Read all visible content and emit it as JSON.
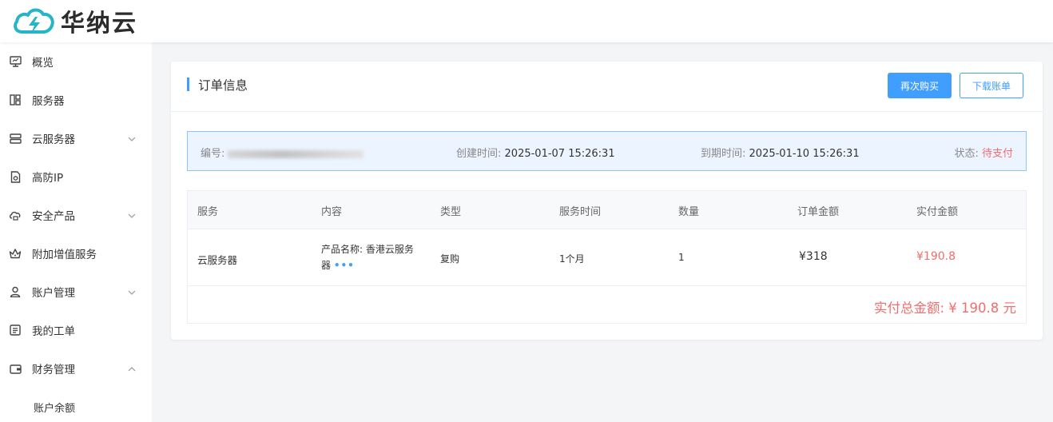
{
  "brand": {
    "name": "华纳云",
    "accent": "#409eff",
    "logo_color": "#25b4c8"
  },
  "sidebar": {
    "items": [
      {
        "label": "概览",
        "icon": "monitor-icon",
        "expandable": false
      },
      {
        "label": "服务器",
        "icon": "layout-icon",
        "expandable": false
      },
      {
        "label": "云服务器",
        "icon": "server-icon",
        "expandable": true,
        "expanded": false
      },
      {
        "label": "高防IP",
        "icon": "shield-doc-icon",
        "expandable": false
      },
      {
        "label": "安全产品",
        "icon": "cloud-lock-icon",
        "expandable": true,
        "expanded": false
      },
      {
        "label": "附加增值服务",
        "icon": "crown-icon",
        "expandable": false
      },
      {
        "label": "账户管理",
        "icon": "user-icon",
        "expandable": true,
        "expanded": false
      },
      {
        "label": "我的工单",
        "icon": "ticket-icon",
        "expandable": false
      },
      {
        "label": "财务管理",
        "icon": "wallet-icon",
        "expandable": true,
        "expanded": true
      }
    ],
    "sub_items": [
      {
        "label": "账户余额"
      }
    ]
  },
  "order": {
    "title": "订单信息",
    "buttons": {
      "buy_again": "再次购买",
      "download_bill": "下载账单"
    },
    "info": {
      "id_label": "编号:",
      "created_label": "创建时间:",
      "created_value": "2025-01-07 15:26:31",
      "expire_label": "到期时间:",
      "expire_value": "2025-01-10 15:26:31",
      "status_label": "状态:",
      "status_value": "待支付"
    },
    "table": {
      "headers": [
        "服务",
        "内容",
        "类型",
        "服务时间",
        "数量",
        "订单金额",
        "实付金额"
      ],
      "rows": [
        {
          "service": "云服务器",
          "content_line1": "产品名称: 香港云服务",
          "content_line2": "器",
          "more": "•••",
          "type": "复购",
          "duration": "1个月",
          "quantity": "1",
          "order_amount": "¥318",
          "paid_amount": "¥190.8"
        }
      ],
      "total": "实付总金额: ¥ 190.8 元"
    }
  }
}
